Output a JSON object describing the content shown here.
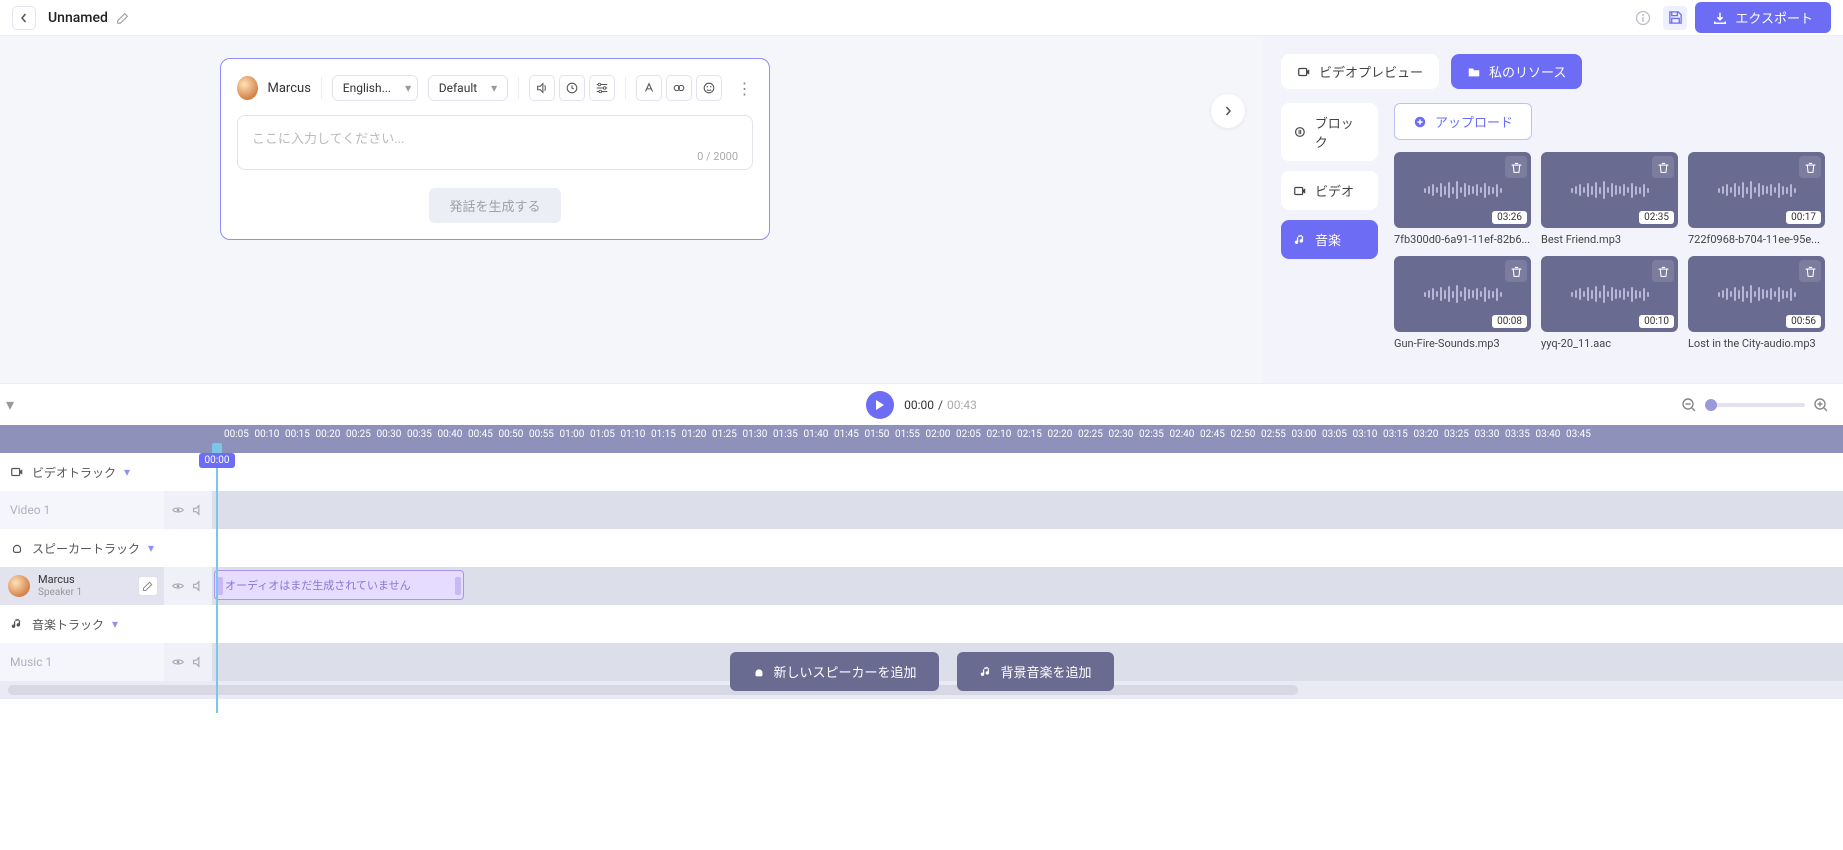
{
  "topbar": {
    "title": "Unnamed",
    "export_label": "エクスポート"
  },
  "editor": {
    "voice_name": "Marcus",
    "language": "English...",
    "style": "Default",
    "placeholder": "ここに入力してください...",
    "char_count": "0 / 2000",
    "generate_label": "発話を生成する"
  },
  "right": {
    "preview_label": "ビデオプレビュー",
    "myres_label": "私のリソース",
    "upload_label": "アップロード",
    "sub_tabs": {
      "block": "ブロック",
      "video": "ビデオ",
      "music": "音楽"
    },
    "assets": [
      {
        "dur": "03:26",
        "name": "7fb300d0-6a91-11ef-82b6..."
      },
      {
        "dur": "02:35",
        "name": "Best Friend.mp3"
      },
      {
        "dur": "00:17",
        "name": "722f0968-b704-11ee-95e..."
      },
      {
        "dur": "00:08",
        "name": "Gun-Fire-Sounds.mp3"
      },
      {
        "dur": "00:10",
        "name": "yyq-20_11.aac"
      },
      {
        "dur": "00:56",
        "name": "Lost in the City-audio.mp3"
      }
    ]
  },
  "playback": {
    "current": "00:00",
    "sep": "/",
    "total": "00:43",
    "playhead_label": "00:00"
  },
  "timeline": {
    "ticks": [
      "00:05",
      "00:10",
      "00:15",
      "00:20",
      "00:25",
      "00:30",
      "00:35",
      "00:40",
      "00:45",
      "00:50",
      "00:55",
      "01:00",
      "01:05",
      "01:10",
      "01:15",
      "01:20",
      "01:25",
      "01:30",
      "01:35",
      "01:40",
      "01:45",
      "01:50",
      "01:55",
      "02:00",
      "02:05",
      "02:10",
      "02:15",
      "02:20",
      "02:25",
      "02:30",
      "02:35",
      "02:40",
      "02:45",
      "02:50",
      "02:55",
      "03:00",
      "03:05",
      "03:10",
      "03:15",
      "03:20",
      "03:25",
      "03:30",
      "03:35",
      "03:40",
      "03:45"
    ],
    "video_track_label": "ビデオトラック",
    "video1_label": "Video 1",
    "speaker_track_label": "スピーカートラック",
    "speaker_name": "Marcus",
    "speaker_sub": "Speaker 1",
    "clip_label": "オーディオはまだ生成されていません",
    "music_track_label": "音楽トラック",
    "music1_label": "Music 1"
  },
  "bottom": {
    "add_speaker": "新しいスピーカーを追加",
    "add_bgm": "背景音楽を追加"
  }
}
